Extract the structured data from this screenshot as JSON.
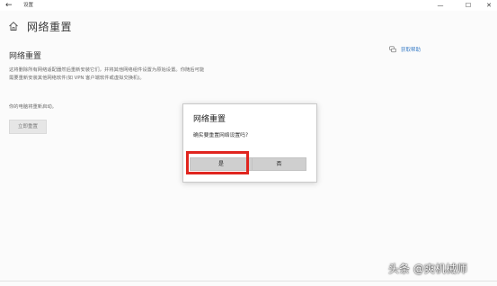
{
  "window": {
    "title": "设置",
    "back_glyph": "←",
    "minimize_glyph": "—",
    "maximize_glyph": "☐",
    "close_glyph": "✕"
  },
  "header": {
    "title": "网络重置",
    "home_icon": "home-icon"
  },
  "content": {
    "section_title": "网络重置",
    "description": "这将删除所有网络适配器然后重新安装它们，并将其他网络组件设置为原始设置。你随后可能需要重新安装其他网络软件(如 VPN 客户端软件或虚拟交换机)。",
    "restart_note": "你的电脑将重新启动。",
    "reset_button": "立即重置"
  },
  "help": {
    "label": "获取帮助",
    "icon": "help-chat-icon"
  },
  "dialog": {
    "title": "网络重置",
    "message": "确实要重置网络设置吗?",
    "yes_label": "是",
    "no_label": "否"
  },
  "highlight_color": "#e0251f",
  "watermark": "头条 @爽机械师"
}
